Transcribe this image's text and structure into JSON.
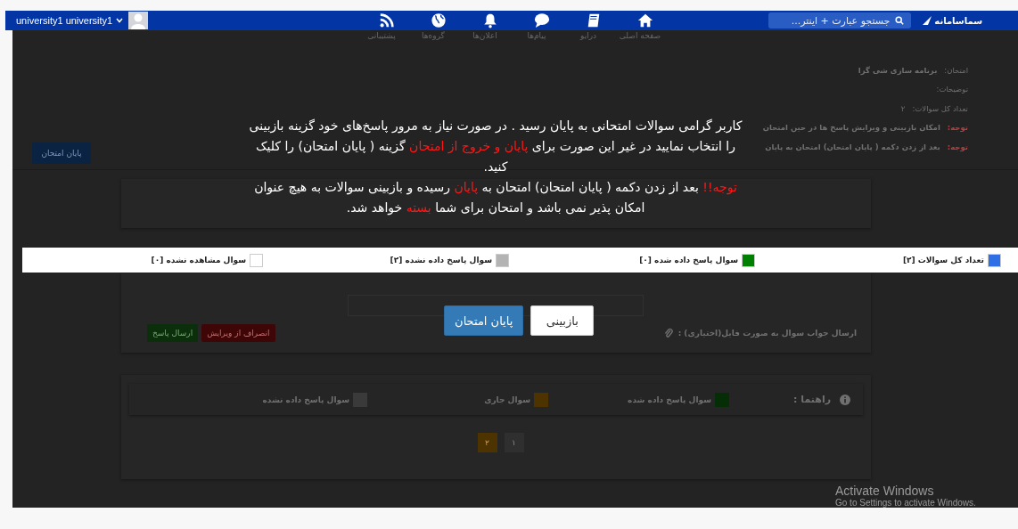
{
  "navbar": {
    "user_name": "university1 university1",
    "logo": "سماسامانه",
    "search": {
      "placeholder": "جستجو عبارت + اینتر..."
    },
    "items": [
      {
        "kind": "home",
        "label": "صفحه اصلی"
      },
      {
        "kind": "book",
        "label": "درایو"
      },
      {
        "kind": "chat",
        "label": "پیام‌ها"
      },
      {
        "kind": "bell",
        "label": "اعلان‌ها"
      },
      {
        "kind": "globe",
        "label": "گروه‌ها"
      },
      {
        "kind": "rss",
        "label": "پشتیبانی"
      }
    ]
  },
  "exam": {
    "title_label": "امتحان:",
    "title": "برنامه سازی شی گرا",
    "description_label": "توضیحات:",
    "count_label": "تعداد کل سوالات:",
    "count": "۲",
    "notes": [
      {
        "label": "توجه:",
        "text": "امکان بازبینی و ویرایش پاسخ ها در حین امتحان"
      },
      {
        "label": "توجه:",
        "text": "بعد از زدن دکمه ( پایان امتحان) امتحان به پایان"
      }
    ],
    "finish_button": "پایان امتحان"
  },
  "legend": [
    {
      "label": "تعداد کل سوالات [۲]",
      "color": "#2f6fe6"
    },
    {
      "label": "سوال پاسخ داده شده [۰]",
      "color": "#008000"
    },
    {
      "label": "سوال پاسخ داده نشده [۲]",
      "color": "#b3b3b3"
    },
    {
      "label": "سوال مشاهده نشده [۰]",
      "color": "#ffffff"
    }
  ],
  "answer": {
    "file_label": "ارسال جواب سوال به صورت فایل(اختیاری) :",
    "buttons": [
      {
        "label": "انصراف از ویرایش",
        "kind": "danger"
      },
      {
        "label": "ارسال پاسخ",
        "kind": "success"
      }
    ]
  },
  "guide": {
    "title": "راهنما :",
    "items": [
      {
        "label": "سوال پاسخ داده شده",
        "color": "#062e06"
      },
      {
        "label": "سوال جاری",
        "color": "#4d3300"
      },
      {
        "label": "سوال پاسخ داده نشده",
        "color": "#3a3a3a"
      }
    ]
  },
  "pagination": [
    {
      "label": "۱",
      "selected": false
    },
    {
      "label": "۲",
      "selected": true
    }
  ],
  "modal": {
    "paragraphs": [
      [
        {
          "text": "کاربر گرامی سوالات امتحانی به پایان رسید . در صورت نیاز به مرور پاسخ‌های خود گزینه بازبینی را انتخاب نمایید در غیر این صورت برای ",
          "highlight": false
        },
        {
          "text": "پایان و خروج از امتحان",
          "highlight": true
        },
        {
          "text": " گزینه ( پایان امتحان) را کلیک کنید.",
          "highlight": false
        }
      ],
      [
        {
          "text": "توجه!!",
          "highlight": true
        },
        {
          "text": " بعد از زدن دکمه ( پایان امتحان) امتحان به ",
          "highlight": false
        },
        {
          "text": "پایان",
          "highlight": true
        },
        {
          "text": " رسیده و بازبینی سوالات به هیچ عنوان امکان پذیر نمی باشد و امتحان برای شما ",
          "highlight": false
        },
        {
          "text": "بسته",
          "highlight": true
        },
        {
          "text": " خواهد شد.",
          "highlight": false
        }
      ]
    ],
    "buttons": [
      {
        "label": "بازبینی",
        "kind": "default"
      },
      {
        "label": "پایان امتحان",
        "kind": "primary"
      }
    ]
  },
  "os_notice": {
    "title": "Activate Windows",
    "subtitle": "Go to Settings to activate Windows."
  }
}
